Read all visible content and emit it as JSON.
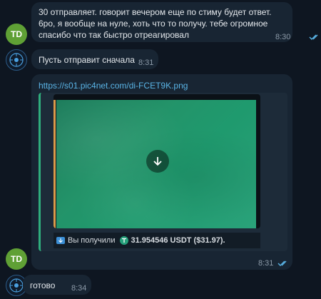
{
  "messages": [
    {
      "sender_initials": "TD",
      "text": "30 отправляет. говорит вечером еще по стиму будет ответ. 6ро, я вообще на нуле, хоть что то получу. тебе огромное спасибо что так быстро отреагировал",
      "time": "8:30"
    },
    {
      "text": "Пусть отправит сначала",
      "time": "8:31"
    },
    {
      "sender_initials": "TD",
      "link": "https://s01.pic4net.com/di-FCET9K.png",
      "caption_prefix": "Вы получили",
      "caption_amount": "31.954546 USDT ($31.97).",
      "time": "8:31"
    },
    {
      "text": "готово",
      "time": "8:34"
    }
  ],
  "colors": {
    "background": "#0e1621",
    "bubble": "#182533",
    "link": "#5ab4e6",
    "avatar_td": "#5fa035",
    "preview_accent": "#2fae7d"
  },
  "icons": {
    "read_receipt": "double-check-icon",
    "download": "download-arrow-icon",
    "usdt": "tether-icon",
    "wallet": "wallet-icon"
  }
}
